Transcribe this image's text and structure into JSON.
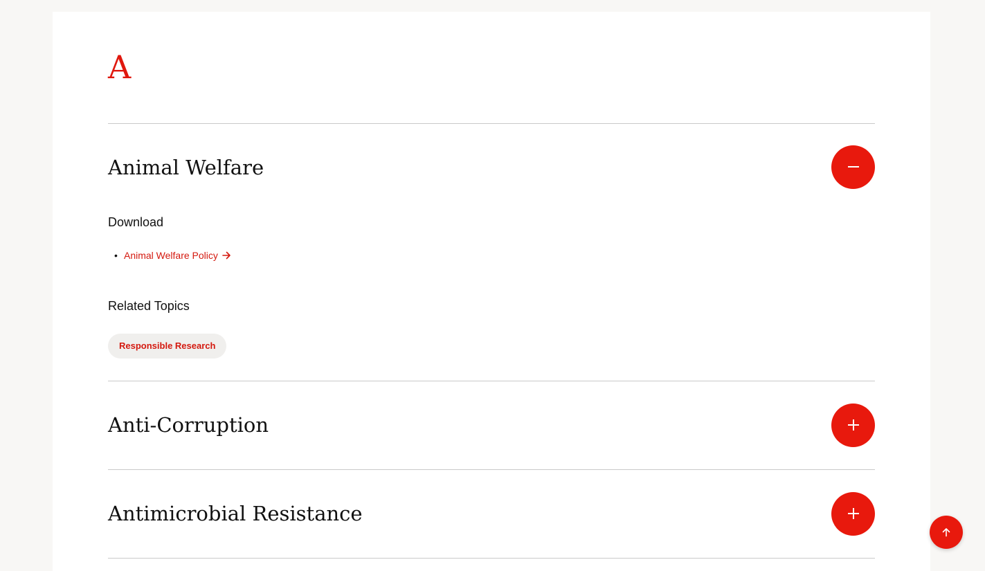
{
  "index": {
    "letter": "A"
  },
  "accordion": [
    {
      "title": "Animal Welfare",
      "expanded": true,
      "toggle_icon": "minus-icon",
      "download_label": "Download",
      "downloads": [
        {
          "label": "Animal Welfare Policy",
          "icon": "arrow-right-icon"
        }
      ],
      "related_label": "Related Topics",
      "related": [
        {
          "label": "Responsible Research"
        }
      ]
    },
    {
      "title": "Anti-Corruption",
      "expanded": false,
      "toggle_icon": "plus-icon"
    },
    {
      "title": "Antimicrobial Resistance",
      "expanded": false,
      "toggle_icon": "plus-icon"
    }
  ],
  "back_to_top": {
    "icon": "arrow-up-icon"
  },
  "colors": {
    "accent": "#e8190d",
    "link": "#d4190f",
    "divider": "#c9c9c9",
    "chip_bg": "#f0efed",
    "page_bg": "#f8f7f5"
  }
}
